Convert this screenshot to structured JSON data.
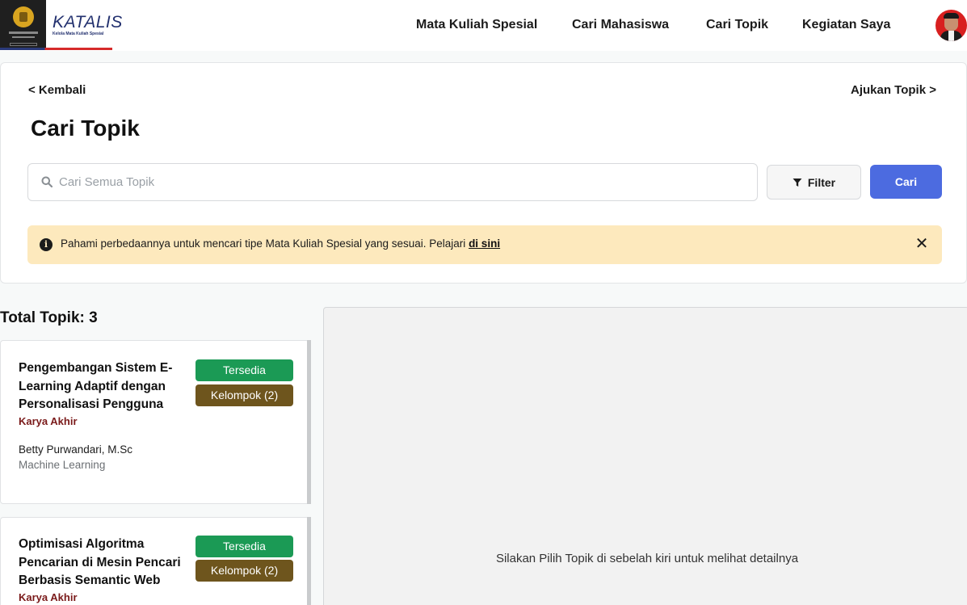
{
  "header": {
    "brand_name": "KATALIS",
    "brand_tagline": "Kelola Mata Kuliah Spesial",
    "nav": [
      "Mata Kuliah Spesial",
      "Cari Mahasiswa",
      "Cari Topik",
      "Kegiatan Saya"
    ]
  },
  "search_card": {
    "back_label": "< Kembali",
    "propose_label": "Ajukan Topik >",
    "title": "Cari Topik",
    "search_placeholder": "Cari Semua Topik",
    "search_value": "",
    "filter_label": "Filter",
    "search_button_label": "Cari",
    "info": {
      "text": "Pahami perbedaannya untuk mencari tipe Mata Kuliah Spesial yang sesuai. Pelajari ",
      "link_text": "di sini",
      "close_symbol": "✕"
    }
  },
  "results": {
    "total_label": "Total Topik: 3",
    "topics": [
      {
        "title": "Pengembangan Sistem E-Learning Adaptif dengan Personalisasi Pengguna",
        "type": "Karya Akhir",
        "lecturer": "Betty Purwandari, M.Sc",
        "field": "Machine Learning",
        "status": "Tersedia",
        "group": "Kelompok (2)"
      },
      {
        "title": "Optimisasi Algoritma Pencarian di Mesin Pencari Berbasis Semantic Web",
        "type": "Karya Akhir",
        "lecturer": "",
        "field": "",
        "status": "Tersedia",
        "group": "Kelompok (2)"
      }
    ]
  },
  "detail": {
    "empty_text": "Silakan Pilih Topik di sebelah kiri untuk melihat detailnya"
  },
  "colors": {
    "primary_button": "#4c6be0",
    "badge_available": "#1b9a55",
    "badge_group": "#6e551d",
    "info_background": "#fde9bd",
    "type_text": "#7a1a1a"
  },
  "icons": {
    "logo": "university-emblem-icon",
    "search": "search-icon",
    "filter": "filter-funnel-icon",
    "info": "info-circle-icon",
    "close": "close-icon",
    "avatar": "user-avatar-icon"
  }
}
